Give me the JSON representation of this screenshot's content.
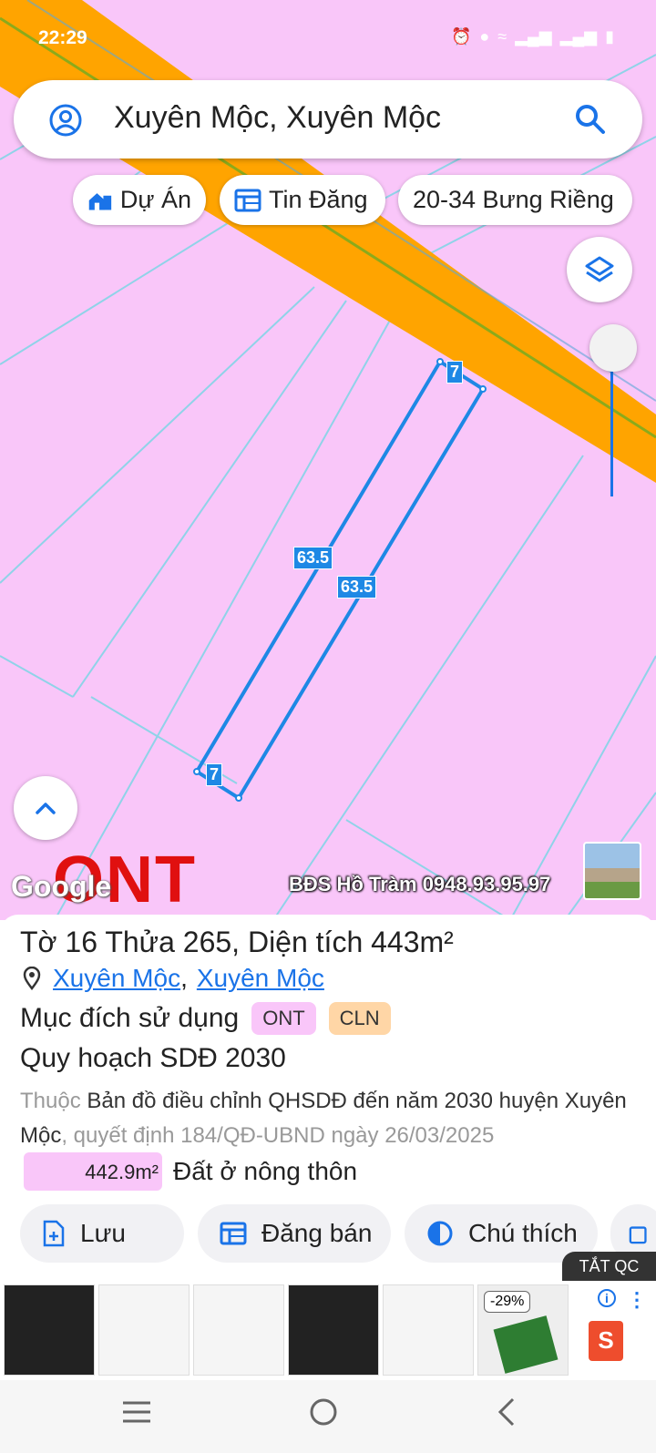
{
  "status_bar": {
    "time": "22:29"
  },
  "search": {
    "title": "Xuyên Mộc, Xuyên Mộc"
  },
  "chips": {
    "du_an": "Dự Án",
    "tin_dang": "Tin Đăng",
    "address": "20-34 Bưng Riềng"
  },
  "map": {
    "edge_labels": {
      "top": "7",
      "left": "63.5",
      "right": "63.5",
      "bottom": "7"
    },
    "zone_label": "ONT",
    "google_label": "Google",
    "watermark": "BĐS Hồ Tràm 0948.93.95.97",
    "colors": {
      "land": "#f9c6f9",
      "road": "#ffa400",
      "parcel_line": "#1e88e5"
    }
  },
  "parcel": {
    "title": "Tờ 16 Thửa 265, Diện tích 443m²",
    "location_1": "Xuyên Mộc",
    "location_sep": ",",
    "location_2": "Xuyên Mộc",
    "purpose_label": "Mục đích sử dụng",
    "tags": [
      "ONT",
      "CLN"
    ],
    "tag_colors": [
      "#f9c6f9",
      "#ffd6a6"
    ],
    "plan_title": "Quy hoạch SDĐ 2030",
    "plan_prefix": "Thuộc",
    "plan_map": "Bản đồ điều chỉnh QHSDĐ đến năm 2030 huyện Xuyên Mộc",
    "plan_decision": ", quyết định 184/QĐ-UBND ngày 26/03/2025",
    "area_value": "442.9m²",
    "area_desc": "Đất ở nông thôn"
  },
  "actions": {
    "save": "Lưu",
    "post": "Đăng bán",
    "legend": "Chú thích"
  },
  "ad": {
    "close_label": "TẮT QC",
    "discount": "-29%"
  }
}
